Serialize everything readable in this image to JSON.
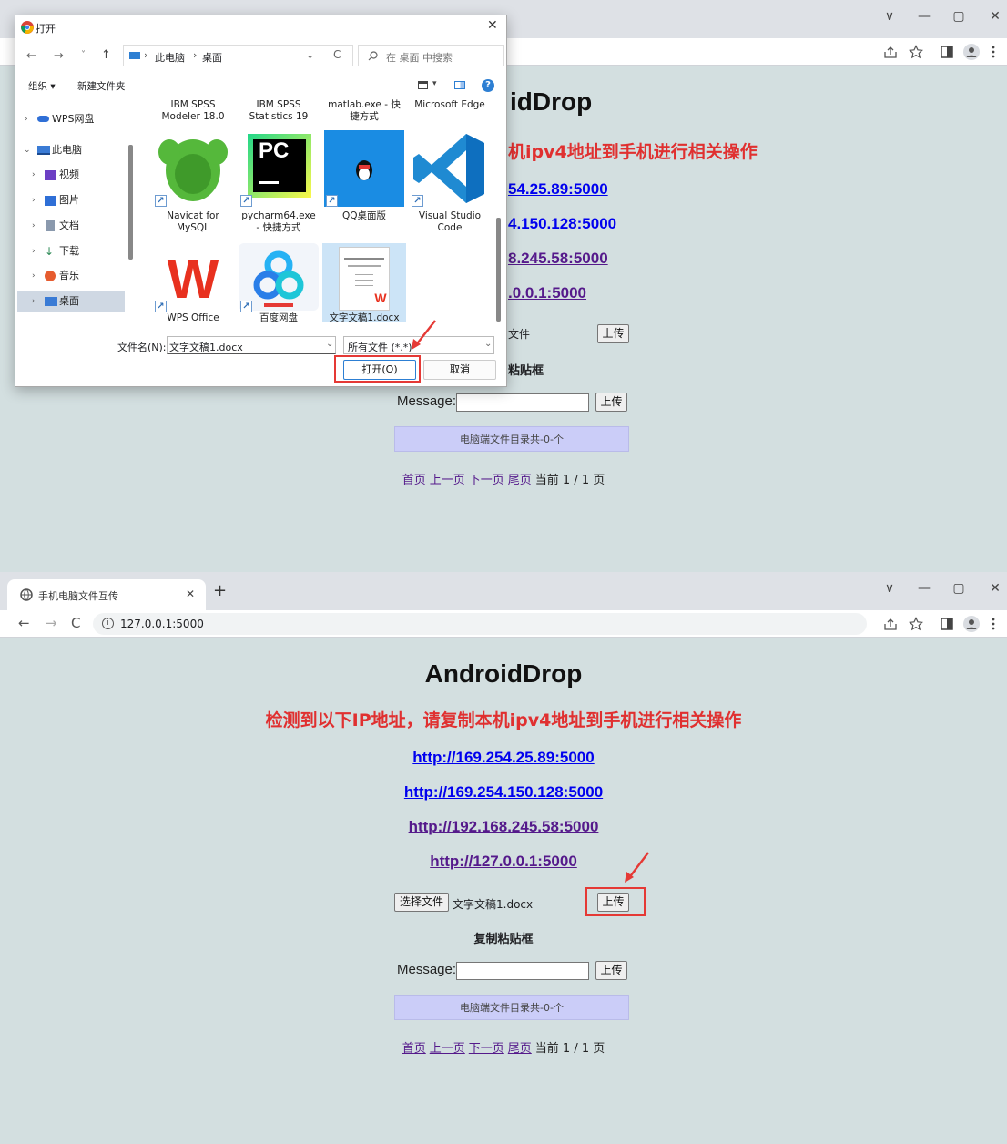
{
  "colors": {
    "page_bg": "#d3dfe0",
    "subtitle": "#e03030",
    "dir_box": "#cbcdf8",
    "highlight": "#e53935",
    "link_visited": "#551a8b",
    "link": "#0000ee"
  },
  "browser_top": {
    "controls": [
      "∨",
      "—",
      "▢",
      "✕"
    ],
    "url_icons": [
      "share-icon",
      "star-icon",
      "sidebar-icon",
      "profile-icon",
      "menu-icon"
    ]
  },
  "page_top": {
    "title_partial": "idDrop",
    "subtitle_partial": "机ipv4地址到手机进行相关操作",
    "links_partial": [
      "54.25.89:5000",
      "4.150.128:5000",
      "8.245.58:5000",
      ".0.0.1:5000"
    ],
    "file_label_partial": "文件",
    "upload_label": "上传",
    "clipboard_partial": "粘贴框",
    "message_label": "Message:",
    "dir_text": "电脑端文件目录共-0-个",
    "pager": {
      "first": "首页",
      "prev": "上一页",
      "next": "下一页",
      "last": "尾页",
      "current": "当前 1 / 1 页"
    }
  },
  "dialog": {
    "title": "打开",
    "close": "✕",
    "nav_back": "←",
    "nav_forward": "→",
    "nav_up": "↑",
    "nav_refresh": "C",
    "path": [
      "此电脑",
      "桌面"
    ],
    "search_placeholder": "在 桌面 中搜索",
    "organize": "组织 ▾",
    "new_folder": "新建文件夹",
    "tree": [
      {
        "label": "WPS网盘",
        "icon": "cloud-icon",
        "color": "#2f6fd6"
      },
      {
        "label": "此电脑",
        "icon": "computer-icon",
        "color": "#3a7bd5"
      },
      {
        "label": "视频",
        "icon": "video-icon",
        "color": "#6c3fc4"
      },
      {
        "label": "图片",
        "icon": "picture-icon",
        "color": "#2f6fd6"
      },
      {
        "label": "文档",
        "icon": "document-icon",
        "color": "#8a99ad"
      },
      {
        "label": "下载",
        "icon": "download-icon",
        "color": "#2e8b57"
      },
      {
        "label": "音乐",
        "icon": "music-icon",
        "color": "#e65c2f"
      },
      {
        "label": "桌面",
        "icon": "desktop-icon",
        "color": "#3a7bd5"
      }
    ],
    "top_row": [
      {
        "line1": "IBM SPSS",
        "line2": "Modeler 18.0"
      },
      {
        "line1": "IBM SPSS",
        "line2": "Statistics 19"
      },
      {
        "line1": "matlab.exe - 快",
        "line2": "捷方式"
      },
      {
        "line1": "Microsoft Edge",
        "line2": ""
      }
    ],
    "tiles": [
      {
        "line1": "Navicat for",
        "line2": "MySQL",
        "icon": "navicat-icon"
      },
      {
        "line1": "pycharm64.exe",
        "line2": "- 快捷方式",
        "icon": "pycharm-icon",
        "glyph": "PC"
      },
      {
        "line1": "QQ桌面版",
        "line2": "",
        "icon": "qq-icon"
      },
      {
        "line1": "Visual Studio",
        "line2": "Code",
        "icon": "vscode-icon"
      },
      {
        "line1": "WPS Office",
        "line2": "",
        "icon": "wps-icon",
        "glyph": "W"
      },
      {
        "line1": "百度网盘",
        "line2": "",
        "icon": "baidu-netdisk-icon"
      },
      {
        "line1": "文字文稿1.docx",
        "line2": "",
        "icon": "docx-thumbnail-icon",
        "glyph": "W"
      }
    ],
    "filename_label": "文件名(N):",
    "filename_value": "文字文稿1.docx",
    "filetype_value": "所有文件 (*.*)",
    "open_label": "打开(O)",
    "cancel_label": "取消"
  },
  "tab": {
    "title": "手机电脑文件互传",
    "close": "✕",
    "new_tab": "+"
  },
  "url": {
    "address": "127.0.0.1:5000"
  },
  "page_bottom": {
    "title": "AndroidDrop",
    "subtitle": "检测到以下IP地址，请复制本机ipv4地址到手机进行相关操作",
    "links": [
      "http://169.254.25.89:5000",
      "http://169.254.150.128:5000",
      "http://192.168.245.58:5000",
      "http://127.0.0.1:5000"
    ],
    "choose_file": "选择文件",
    "chosen_name": "文字文稿1.docx",
    "upload_label": "上传",
    "clipboard_heading": "复制粘贴框",
    "message_label": "Message:",
    "dir_text": "电脑端文件目录共-0-个",
    "pager": {
      "first": "首页",
      "prev": "上一页",
      "next": "下一页",
      "last": "尾页",
      "current": "当前 1 / 1 页"
    }
  }
}
